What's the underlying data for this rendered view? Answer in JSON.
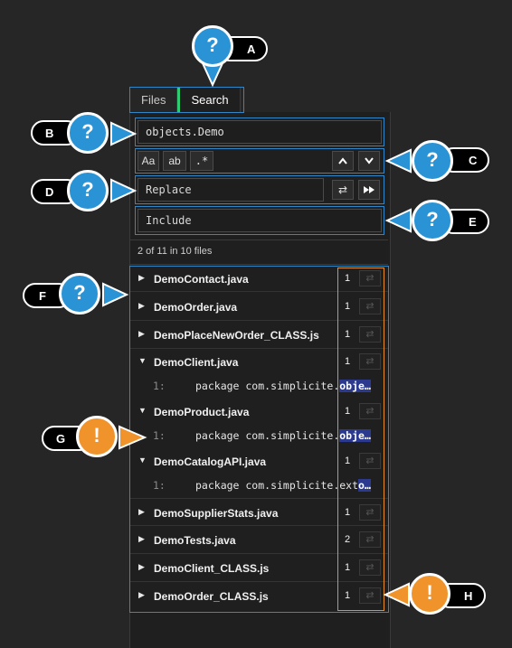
{
  "tabs": {
    "files": "Files",
    "search": "Search"
  },
  "search": {
    "query": "objects.Demo",
    "replace_placeholder": "Replace",
    "include_placeholder": "Include",
    "opt_case": "Aa",
    "opt_word": "ab",
    "opt_regex": ".*"
  },
  "status": "2 of 11 in 10 files",
  "results": [
    {
      "file": "DemoContact.java",
      "count": "1"
    },
    {
      "file": "DemoOrder.java",
      "count": "1"
    },
    {
      "file": "DemoPlaceNewOrder_CLASS.js",
      "count": "1"
    },
    {
      "file": "DemoClient.java",
      "count": "1",
      "line": "1:",
      "pre": "package com.simplicite.",
      "hit": "obje…"
    },
    {
      "file": "DemoProduct.java",
      "count": "1",
      "line": "1:",
      "pre": "package com.simplicite.",
      "hit": "obje…"
    },
    {
      "file": "DemoCatalogAPI.java",
      "count": "1",
      "line": "1:",
      "pre": "package com.simplicite.ext",
      "hit": "o…"
    },
    {
      "file": "DemoSupplierStats.java",
      "count": "1"
    },
    {
      "file": "DemoTests.java",
      "count": "2"
    },
    {
      "file": "DemoClient_CLASS.js",
      "count": "1"
    },
    {
      "file": "DemoOrder_CLASS.js",
      "count": "1"
    }
  ],
  "callouts": {
    "a": "A",
    "b": "B",
    "c": "C",
    "d": "D",
    "e": "E",
    "f": "F",
    "g": "G",
    "h": "H"
  },
  "colors": {
    "accent_blue": "#2a93d5",
    "accent_orange": "#f0932b",
    "tab_active": "#2ecc71",
    "match_bg": "#2b3a8f"
  }
}
